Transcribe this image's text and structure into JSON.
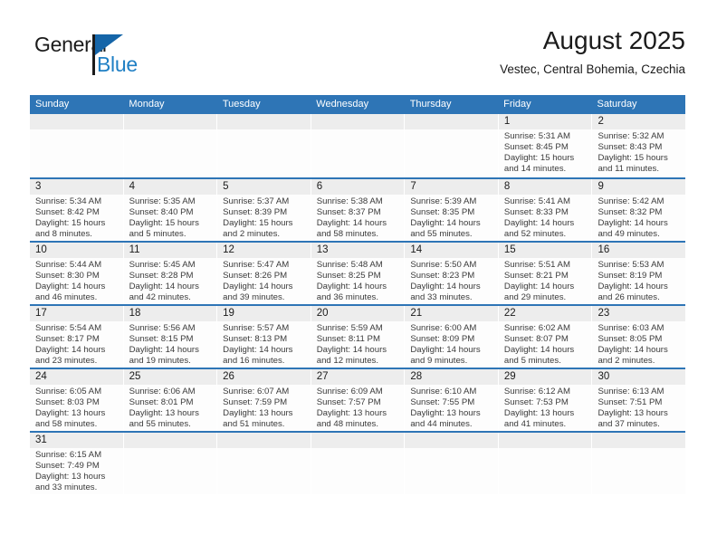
{
  "logo": {
    "word1": "General",
    "word2": "Blue",
    "flag_icon": "blue-flag-icon"
  },
  "header": {
    "title": "August 2025",
    "subtitle": "Vestec, Central Bohemia, Czechia"
  },
  "colors": {
    "header_blue": "#2e75b6",
    "day_band_gray": "#ededed",
    "logo_blue": "#1f7fc4",
    "text": "#1b1b1b"
  },
  "calendar": {
    "weekdays": [
      "Sunday",
      "Monday",
      "Tuesday",
      "Wednesday",
      "Thursday",
      "Friday",
      "Saturday"
    ],
    "weeks": [
      [
        {
          "day": "",
          "empty": true
        },
        {
          "day": "",
          "empty": true
        },
        {
          "day": "",
          "empty": true
        },
        {
          "day": "",
          "empty": true
        },
        {
          "day": "",
          "empty": true
        },
        {
          "day": "1",
          "sunrise": "Sunrise: 5:31 AM",
          "sunset": "Sunset: 8:45 PM",
          "daylight1": "Daylight: 15 hours",
          "daylight2": "and 14 minutes."
        },
        {
          "day": "2",
          "sunrise": "Sunrise: 5:32 AM",
          "sunset": "Sunset: 8:43 PM",
          "daylight1": "Daylight: 15 hours",
          "daylight2": "and 11 minutes."
        }
      ],
      [
        {
          "day": "3",
          "sunrise": "Sunrise: 5:34 AM",
          "sunset": "Sunset: 8:42 PM",
          "daylight1": "Daylight: 15 hours",
          "daylight2": "and 8 minutes."
        },
        {
          "day": "4",
          "sunrise": "Sunrise: 5:35 AM",
          "sunset": "Sunset: 8:40 PM",
          "daylight1": "Daylight: 15 hours",
          "daylight2": "and 5 minutes."
        },
        {
          "day": "5",
          "sunrise": "Sunrise: 5:37 AM",
          "sunset": "Sunset: 8:39 PM",
          "daylight1": "Daylight: 15 hours",
          "daylight2": "and 2 minutes."
        },
        {
          "day": "6",
          "sunrise": "Sunrise: 5:38 AM",
          "sunset": "Sunset: 8:37 PM",
          "daylight1": "Daylight: 14 hours",
          "daylight2": "and 58 minutes."
        },
        {
          "day": "7",
          "sunrise": "Sunrise: 5:39 AM",
          "sunset": "Sunset: 8:35 PM",
          "daylight1": "Daylight: 14 hours",
          "daylight2": "and 55 minutes."
        },
        {
          "day": "8",
          "sunrise": "Sunrise: 5:41 AM",
          "sunset": "Sunset: 8:33 PM",
          "daylight1": "Daylight: 14 hours",
          "daylight2": "and 52 minutes."
        },
        {
          "day": "9",
          "sunrise": "Sunrise: 5:42 AM",
          "sunset": "Sunset: 8:32 PM",
          "daylight1": "Daylight: 14 hours",
          "daylight2": "and 49 minutes."
        }
      ],
      [
        {
          "day": "10",
          "sunrise": "Sunrise: 5:44 AM",
          "sunset": "Sunset: 8:30 PM",
          "daylight1": "Daylight: 14 hours",
          "daylight2": "and 46 minutes."
        },
        {
          "day": "11",
          "sunrise": "Sunrise: 5:45 AM",
          "sunset": "Sunset: 8:28 PM",
          "daylight1": "Daylight: 14 hours",
          "daylight2": "and 42 minutes."
        },
        {
          "day": "12",
          "sunrise": "Sunrise: 5:47 AM",
          "sunset": "Sunset: 8:26 PM",
          "daylight1": "Daylight: 14 hours",
          "daylight2": "and 39 minutes."
        },
        {
          "day": "13",
          "sunrise": "Sunrise: 5:48 AM",
          "sunset": "Sunset: 8:25 PM",
          "daylight1": "Daylight: 14 hours",
          "daylight2": "and 36 minutes."
        },
        {
          "day": "14",
          "sunrise": "Sunrise: 5:50 AM",
          "sunset": "Sunset: 8:23 PM",
          "daylight1": "Daylight: 14 hours",
          "daylight2": "and 33 minutes."
        },
        {
          "day": "15",
          "sunrise": "Sunrise: 5:51 AM",
          "sunset": "Sunset: 8:21 PM",
          "daylight1": "Daylight: 14 hours",
          "daylight2": "and 29 minutes."
        },
        {
          "day": "16",
          "sunrise": "Sunrise: 5:53 AM",
          "sunset": "Sunset: 8:19 PM",
          "daylight1": "Daylight: 14 hours",
          "daylight2": "and 26 minutes."
        }
      ],
      [
        {
          "day": "17",
          "sunrise": "Sunrise: 5:54 AM",
          "sunset": "Sunset: 8:17 PM",
          "daylight1": "Daylight: 14 hours",
          "daylight2": "and 23 minutes."
        },
        {
          "day": "18",
          "sunrise": "Sunrise: 5:56 AM",
          "sunset": "Sunset: 8:15 PM",
          "daylight1": "Daylight: 14 hours",
          "daylight2": "and 19 minutes."
        },
        {
          "day": "19",
          "sunrise": "Sunrise: 5:57 AM",
          "sunset": "Sunset: 8:13 PM",
          "daylight1": "Daylight: 14 hours",
          "daylight2": "and 16 minutes."
        },
        {
          "day": "20",
          "sunrise": "Sunrise: 5:59 AM",
          "sunset": "Sunset: 8:11 PM",
          "daylight1": "Daylight: 14 hours",
          "daylight2": "and 12 minutes."
        },
        {
          "day": "21",
          "sunrise": "Sunrise: 6:00 AM",
          "sunset": "Sunset: 8:09 PM",
          "daylight1": "Daylight: 14 hours",
          "daylight2": "and 9 minutes."
        },
        {
          "day": "22",
          "sunrise": "Sunrise: 6:02 AM",
          "sunset": "Sunset: 8:07 PM",
          "daylight1": "Daylight: 14 hours",
          "daylight2": "and 5 minutes."
        },
        {
          "day": "23",
          "sunrise": "Sunrise: 6:03 AM",
          "sunset": "Sunset: 8:05 PM",
          "daylight1": "Daylight: 14 hours",
          "daylight2": "and 2 minutes."
        }
      ],
      [
        {
          "day": "24",
          "sunrise": "Sunrise: 6:05 AM",
          "sunset": "Sunset: 8:03 PM",
          "daylight1": "Daylight: 13 hours",
          "daylight2": "and 58 minutes."
        },
        {
          "day": "25",
          "sunrise": "Sunrise: 6:06 AM",
          "sunset": "Sunset: 8:01 PM",
          "daylight1": "Daylight: 13 hours",
          "daylight2": "and 55 minutes."
        },
        {
          "day": "26",
          "sunrise": "Sunrise: 6:07 AM",
          "sunset": "Sunset: 7:59 PM",
          "daylight1": "Daylight: 13 hours",
          "daylight2": "and 51 minutes."
        },
        {
          "day": "27",
          "sunrise": "Sunrise: 6:09 AM",
          "sunset": "Sunset: 7:57 PM",
          "daylight1": "Daylight: 13 hours",
          "daylight2": "and 48 minutes."
        },
        {
          "day": "28",
          "sunrise": "Sunrise: 6:10 AM",
          "sunset": "Sunset: 7:55 PM",
          "daylight1": "Daylight: 13 hours",
          "daylight2": "and 44 minutes."
        },
        {
          "day": "29",
          "sunrise": "Sunrise: 6:12 AM",
          "sunset": "Sunset: 7:53 PM",
          "daylight1": "Daylight: 13 hours",
          "daylight2": "and 41 minutes."
        },
        {
          "day": "30",
          "sunrise": "Sunrise: 6:13 AM",
          "sunset": "Sunset: 7:51 PM",
          "daylight1": "Daylight: 13 hours",
          "daylight2": "and 37 minutes."
        }
      ],
      [
        {
          "day": "31",
          "sunrise": "Sunrise: 6:15 AM",
          "sunset": "Sunset: 7:49 PM",
          "daylight1": "Daylight: 13 hours",
          "daylight2": "and 33 minutes."
        },
        {
          "day": "",
          "empty": true
        },
        {
          "day": "",
          "empty": true
        },
        {
          "day": "",
          "empty": true
        },
        {
          "day": "",
          "empty": true
        },
        {
          "day": "",
          "empty": true
        },
        {
          "day": "",
          "empty": true
        }
      ]
    ]
  }
}
